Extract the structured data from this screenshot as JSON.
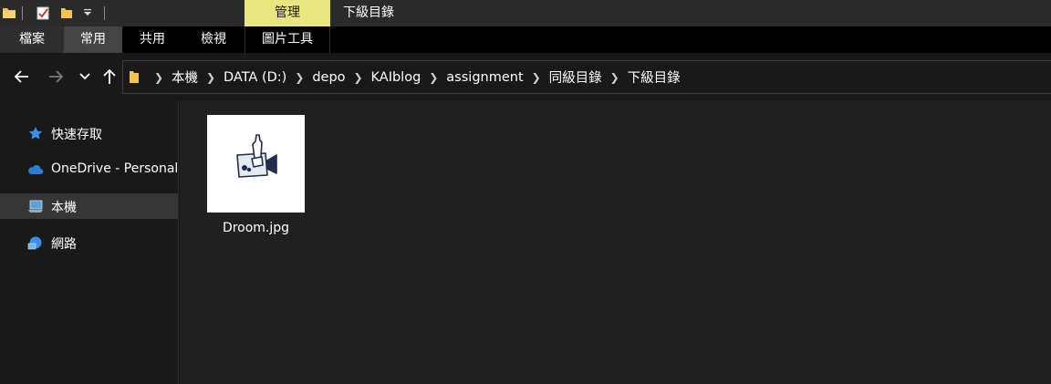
{
  "titlebar": {
    "contextual_tab": "管理",
    "window_title": "下級目錄"
  },
  "ribbon": {
    "tabs": [
      "檔案",
      "常用",
      "共用",
      "檢視",
      "圖片工具"
    ],
    "selected": "常用"
  },
  "address_bar": {
    "crumbs": [
      "本機",
      "DATA (D:)",
      "depo",
      "KAIblog",
      "assignment",
      "同級目錄",
      "下級目錄"
    ]
  },
  "sidebar": {
    "items": [
      {
        "label": "快速存取",
        "icon": "star-icon"
      },
      {
        "label": "OneDrive - Personal",
        "icon": "cloud-icon"
      },
      {
        "label": "本機",
        "icon": "computer-icon",
        "selected": true
      },
      {
        "label": "網路",
        "icon": "network-icon"
      }
    ]
  },
  "files": [
    {
      "name": "Droom.jpg",
      "thumbnail": "drawing-thumbnail-icon"
    }
  ],
  "colors": {
    "contextual_tab_bg": "#e8e582",
    "cloud_blue": "#2a7fd4",
    "star_blue": "#3a8ee6",
    "folder_yellow": "#f3c34a"
  }
}
